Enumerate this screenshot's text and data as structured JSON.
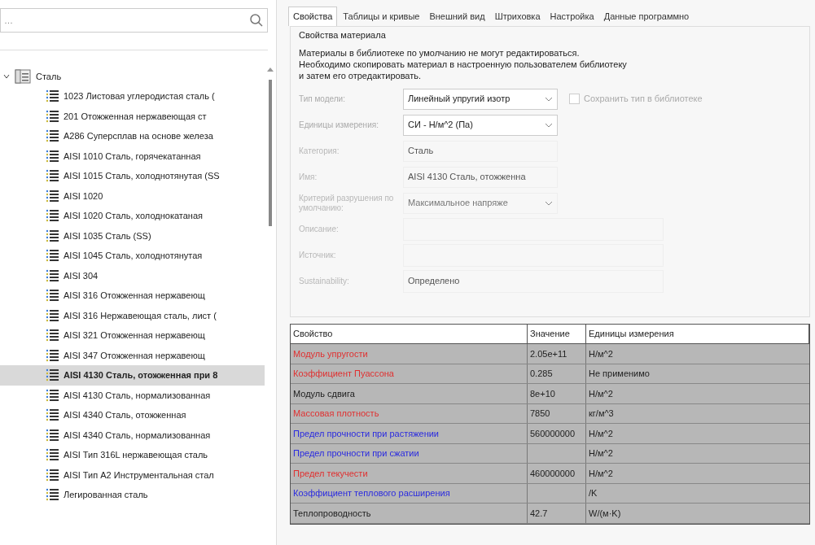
{
  "search": {
    "placeholder": "…"
  },
  "tree": [
    {
      "label": "Сталь",
      "expanded": true,
      "children": [
        {
          "label": "1023 Листовая углеродистая сталь (",
          "selected": false
        },
        {
          "label": "201 Отожженная нержавеющая ст",
          "selected": false
        },
        {
          "label": "A286 Суперсплав на основе железа",
          "selected": false
        },
        {
          "label": "AISI 1010 Сталь, горячекатанная",
          "selected": false
        },
        {
          "label": "AISI 1015 Сталь, холоднотянутая (SS",
          "selected": false
        },
        {
          "label": "AISI 1020",
          "selected": false
        },
        {
          "label": "AISI 1020 Сталь, холоднокатаная",
          "selected": false
        },
        {
          "label": "AISI 1035 Сталь (SS)",
          "selected": false
        },
        {
          "label": "AISI 1045 Сталь, холоднотянутая",
          "selected": false
        },
        {
          "label": "AISI 304",
          "selected": false
        },
        {
          "label": "AISI 316 Отожженная нержавеющ",
          "selected": false
        },
        {
          "label": "AISI 316 Нержавеющая сталь, лист (",
          "selected": false
        },
        {
          "label": "AISI 321 Отожженная нержавеющ",
          "selected": false
        },
        {
          "label": "AISI 347 Отожженная нержавеющ",
          "selected": false
        },
        {
          "label": "AISI 4130 Сталь, отожженная при 8",
          "selected": true
        },
        {
          "label": "AISI 4130 Сталь, нормализованная",
          "selected": false
        },
        {
          "label": "AISI 4340 Сталь, отожженная",
          "selected": false
        },
        {
          "label": "AISI 4340 Сталь, нормализованная",
          "selected": false
        },
        {
          "label": "AISI Тип 316L нержавеющая сталь",
          "selected": false
        },
        {
          "label": "AISI Тип A2 Инструментальная стал",
          "selected": false
        },
        {
          "label": "Легированная сталь",
          "selected": false
        }
      ]
    }
  ],
  "tabs": [
    {
      "label": "Свойства",
      "selected": true
    },
    {
      "label": "Таблицы и кривые",
      "selected": false
    },
    {
      "label": "Внешний вид",
      "selected": false
    },
    {
      "label": "Штриховка",
      "selected": false
    },
    {
      "label": "Настройка",
      "selected": false
    },
    {
      "label": "Данные программно",
      "selected": false
    }
  ],
  "group": {
    "title": "Свойства материала",
    "notice": [
      "Материалы в библиотеке по умолчанию не могут редактироваться.",
      "Необходимо скопировать материал в настроенную пользователем библиотеку",
      "и затем его отредактировать."
    ],
    "fields": [
      {
        "label": "Тип модели:",
        "kind": "select",
        "value": "Линейный упругий изотр",
        "disabled": false,
        "checkbox": {
          "label": "Сохранить тип в библиотеке",
          "checked": false
        }
      },
      {
        "label": "Единицы измерения:",
        "kind": "select",
        "value": "СИ - Н/м^2 (Па)",
        "disabled": false
      },
      {
        "label": "Категория:",
        "kind": "text",
        "value": "Сталь",
        "disabled": true
      },
      {
        "label": "Имя:",
        "kind": "text",
        "value": "AISI 4130 Сталь, отожженна",
        "disabled": true
      },
      {
        "label": "Критерий разрушения по умолчанию:",
        "kind": "select",
        "value": "Максимальное напряже",
        "disabled": true
      },
      {
        "label": "Описание:",
        "kind": "wide",
        "disabled": true
      },
      {
        "label": "Источник:",
        "kind": "wide",
        "disabled": true
      },
      {
        "label": "Sustainability:",
        "kind": "wide",
        "value": "Определено",
        "disabled": true
      }
    ]
  },
  "table": {
    "columns": [
      "Свойство",
      "Значение",
      "Единицы измерения"
    ],
    "rows": [
      {
        "property": "Модуль упругости",
        "color": "#e03030",
        "value": "2.05e+11",
        "units": "Н/м^2"
      },
      {
        "property": "Коэффициент Пуассона",
        "color": "#e03030",
        "value": "0.285",
        "units": "Не применимо"
      },
      {
        "property": "Модуль сдвига",
        "color": "#202020",
        "value": "8e+10",
        "units": "Н/м^2"
      },
      {
        "property": "Массовая плотность",
        "color": "#e03030",
        "value": "7850",
        "units": "кг/м^3"
      },
      {
        "property": "Предел прочности при растяжении",
        "color": "#2a2ae0",
        "value": "560000000",
        "units": "Н/м^2"
      },
      {
        "property": "Предел прочности при сжатии",
        "color": "#2a2ae0",
        "units": "Н/м^2"
      },
      {
        "property": "Предел текучести",
        "color": "#e03030",
        "value": "460000000",
        "units": "Н/м^2"
      },
      {
        "property": "Коэффициент теплового расширения",
        "color": "#2a2ae0",
        "units": "/K"
      },
      {
        "property": "Теплопроводность",
        "color": "#202020",
        "value": "42.7",
        "units": "W/(м·K)"
      }
    ]
  }
}
